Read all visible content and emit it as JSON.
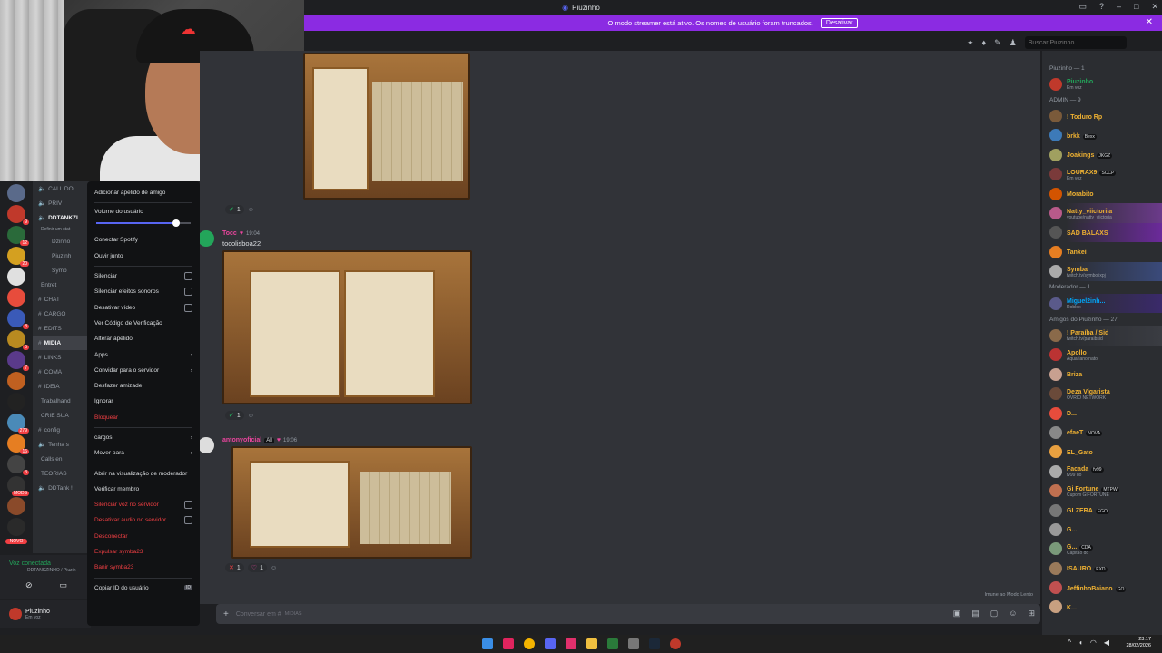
{
  "window": {
    "title": "Piuzinho"
  },
  "banner": {
    "text": "O modo streamer está ativo. Os nomes de usuário foram truncados.",
    "button": "Desativar"
  },
  "search": {
    "placeholder": "Buscar Piuzinho"
  },
  "channels": [
    {
      "icon": "🔈",
      "label": "CALL DO"
    },
    {
      "icon": "🔈",
      "label": "PRIV"
    },
    {
      "icon": "🔈",
      "label": "DDTANKZI",
      "bold": true
    },
    {
      "icon": "",
      "label": "Definir um stat"
    },
    {
      "icon": "",
      "label": "Dzinho"
    },
    {
      "icon": "",
      "label": "Piuzinh"
    },
    {
      "icon": "",
      "label": "Symb"
    },
    {
      "icon": "",
      "label": "Entret"
    },
    {
      "icon": "#",
      "label": "CHAT"
    },
    {
      "icon": "#",
      "label": "CARGO"
    },
    {
      "icon": "#",
      "label": "EDITS"
    },
    {
      "icon": "#",
      "label": "MIDIA",
      "bold": true
    },
    {
      "icon": "#",
      "label": "LINKS"
    },
    {
      "icon": "#",
      "label": "COMA"
    },
    {
      "icon": "#",
      "label": "IDEIA"
    },
    {
      "icon": "",
      "label": "Trabalhand"
    },
    {
      "icon": "",
      "label": "CRIE SUA"
    },
    {
      "icon": "#",
      "label": "config"
    },
    {
      "icon": "🔈",
      "label": "Tenha s"
    },
    {
      "icon": "",
      "label": "Calls en"
    },
    {
      "icon": "",
      "label": "TEORIAS"
    },
    {
      "icon": "🔈",
      "label": "DDTank !"
    }
  ],
  "voice": {
    "status": "Voz conectada",
    "server": "DDTANKZINHO / Piuzin"
  },
  "user": {
    "name": "Piuzinho",
    "status": "Em voz"
  },
  "servers": {
    "novo_badge": "NOVO",
    "badges": [
      "9",
      "12",
      "20",
      "8",
      "5",
      "7",
      "279",
      "16",
      "3",
      "MODS"
    ]
  },
  "context_menu": {
    "add_nickname": "Adicionar apelido de amigo",
    "volume_label": "Volume do usuário",
    "volume_fraction": 0.85,
    "items_a": [
      "Conectar Spotify",
      "Ouvir junto"
    ],
    "checks": [
      "Silenciar",
      "Silenciar efeitos sonoros",
      "Desativar vídeo"
    ],
    "items_b": [
      "Ver Código de Verificação",
      "Alterar apelido"
    ],
    "apps": "Apps",
    "invite": "Convidar para o servidor",
    "unfriend": "Desfazer amizade",
    "ignore": "Ignorar",
    "block": "Bloquear",
    "roles": "cargos",
    "move": "Mover para",
    "moderator_view": "Abrir na visualização de moderador",
    "verify": "Verificar membro",
    "server_mute": "Silenciar voz no servidor",
    "server_deafen": "Desativar áudio no servidor",
    "disconnect": "Desconectar",
    "kick": "Expulsar symba23",
    "ban": "Banir symba23",
    "copy_id": "Copiar ID do usuário",
    "copy_id_badge": "ID"
  },
  "messages": [
    {
      "author": "Tocc",
      "time": "19:04",
      "text": "tocolisboa22",
      "color": "#eb459e",
      "reaction_count": "1"
    },
    {
      "author": "antonyoficial",
      "role": "All",
      "time": "19:06",
      "color": "#eb459e",
      "reaction_count": "1"
    }
  ],
  "first_reaction_count": "1",
  "last_reactions": [
    {
      "emoji": "✕",
      "count": "1"
    },
    {
      "emoji": "♡",
      "count": "1"
    }
  ],
  "composer": {
    "placeholder": "Conversar em #",
    "channel": "MIDIAS"
  },
  "slow_mode": "Imune ao Modo Lento",
  "members": {
    "sections": [
      {
        "title": "Piuzinho — 1",
        "items": [
          {
            "name": "Piuzinho",
            "sub": "Em voz",
            "color": "#23a55a",
            "av": "#c0392b"
          }
        ]
      },
      {
        "title": "ADMIN — 9",
        "items": [
          {
            "name": "! Toduro Rp",
            "color": "#f0b232",
            "av": "#7a5a3a"
          },
          {
            "name": "brkk",
            "tag": "Bexx",
            "color": "#f0b232",
            "av": "#3d7ab8"
          },
          {
            "name": "Joakings",
            "tag": "JKGZ",
            "color": "#f0b232",
            "av": "#a0a060"
          },
          {
            "name": "LOURAX9",
            "tag": "SCCP",
            "sub": "Em voz",
            "color": "#f0b232",
            "av": "#7a3a3a"
          },
          {
            "name": "Morabito",
            "color": "#f0b232",
            "av": "#d35400"
          },
          {
            "name": "Natty_viictoriia",
            "sub": "youtube/natty_viictoria",
            "color": "#f0b232",
            "av": "#b85a8a",
            "hl": "#6b3a8a"
          },
          {
            "name": "SAD BALAXS",
            "color": "#f0b232",
            "av": "#555",
            "hl": "#6b2a9a"
          },
          {
            "name": "Tankei",
            "color": "#f0b232",
            "av": "#e67e22"
          },
          {
            "name": "Symba",
            "sub": "twitch.tv/symbolixpj",
            "color": "#f0b232",
            "av": "#aaa",
            "hl": "#3a4a7a"
          }
        ]
      },
      {
        "title": "Moderador — 1",
        "items": [
          {
            "name": "Miguel2inh...",
            "sub": "Roblox",
            "color": "#00a8fc",
            "av": "#5a5a8a",
            "hl": "#3a2a6a"
          }
        ]
      },
      {
        "title": "Amigos do Piuzinho — 27",
        "items": [
          {
            "name": "! Paraíba / Sid",
            "sub": "twitch.tv/paraibsid",
            "color": "#f0b232",
            "av": "#8a6a4a",
            "hl": "#3a3c42"
          },
          {
            "name": "Apollo",
            "sub": "Aquariano nato",
            "color": "#f0b232",
            "av": "#b33"
          },
          {
            "name": "Briza",
            "color": "#f0b232",
            "av": "#c8a090"
          },
          {
            "name": "Deza Vigarista",
            "sub": "OVRIO NETWORK",
            "color": "#f0b232",
            "av": "#6a4a3a"
          },
          {
            "name": "D...",
            "color": "#f0b232",
            "av": "#e74c3c"
          },
          {
            "name": "efaeT",
            "tag": "NOVA",
            "color": "#f0b232",
            "av": "#888"
          },
          {
            "name": "EL_Gato",
            "color": "#f0b232",
            "av": "#e8a040"
          },
          {
            "name": "Facada",
            "tag": "fv99",
            "sub": "fv99 do",
            "color": "#f0b232",
            "av": "#aaa"
          },
          {
            "name": "Gi Fortune",
            "tag": "MTPW",
            "sub": "Cupom GIFORTUNE",
            "color": "#f0b232",
            "av": "#c07050"
          },
          {
            "name": "GLZERA",
            "tag": "EGO",
            "color": "#f0b232",
            "av": "#777"
          },
          {
            "name": "G...",
            "color": "#f0b232",
            "av": "#999"
          },
          {
            "name": "G...",
            "tag": "CDA",
            "sub": "Capitão do",
            "color": "#f0b232",
            "av": "#7a9a7a"
          },
          {
            "name": "ISAURO",
            "tag": "EXD",
            "color": "#f0b232",
            "av": "#9a7a5a"
          },
          {
            "name": "JeffinhoBaiano",
            "tag": "GO",
            "color": "#f0b232",
            "av": "#c05050"
          },
          {
            "name": "K...",
            "color": "#f0b232",
            "av": "#c8a080"
          }
        ]
      }
    ]
  },
  "clock": {
    "time": "23:17",
    "date": "28/02/2026"
  }
}
